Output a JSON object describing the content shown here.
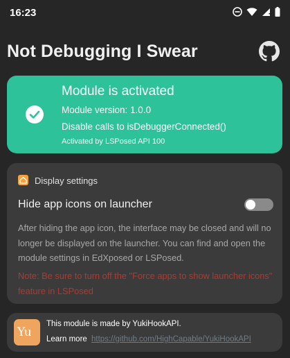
{
  "status_bar": {
    "time": "16:23",
    "icons": [
      "do-not-disturb-icon",
      "wifi-icon",
      "signal-icon",
      "battery-icon"
    ]
  },
  "app": {
    "title": "Not Debugging I Swear",
    "github_icon": "github-icon"
  },
  "module_status": {
    "title": "Module is activated",
    "version": "Module version: 1.0.0",
    "description": "Disable calls to isDebuggerConnected()",
    "activated_by": "Activated by LSPosed API 100",
    "color": "#2ec29b"
  },
  "display_settings": {
    "title": "Display settings",
    "toggle_label": "Hide app icons on launcher",
    "toggle_on": false,
    "description": "After hiding the app icon, the interface may be closed and will no longer be displayed on the launcher. You can find and open the module settings in EdXposed or LSPosed.",
    "note": "Note: Be sure to turn off the \"Force apps to show launcher icons\" feature in LSPosed",
    "accent_color": "#f6a23c",
    "note_color": "#b03a2e"
  },
  "credit": {
    "logo_text": "Yu",
    "line1": "This module is made by YukiHookAPI.",
    "learn_more": "Learn more",
    "link": "https://github.com/HighCapable/YukiHookAPI"
  }
}
